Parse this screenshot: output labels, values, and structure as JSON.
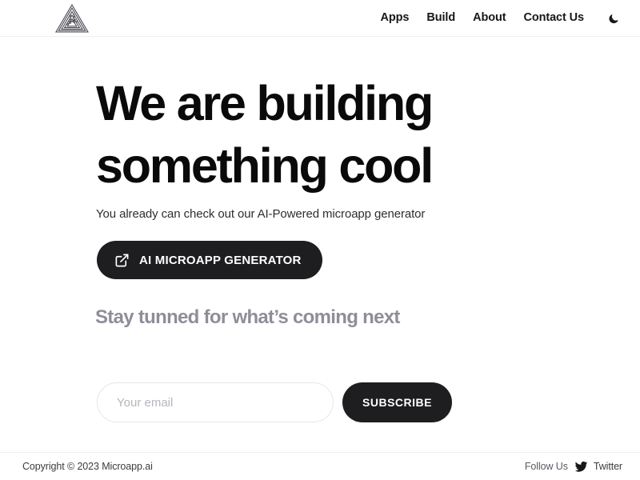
{
  "header": {
    "logo_icon": "impossible-triangle-logo",
    "nav": [
      {
        "label": "Apps"
      },
      {
        "label": "Build"
      },
      {
        "label": "About"
      },
      {
        "label": "Contact Us"
      }
    ],
    "theme_toggle_icon": "moon-icon"
  },
  "hero": {
    "title_line1": "We are building",
    "title_line2": "something cool",
    "subtitle": "You already can check out our AI-Powered microapp generator",
    "cta": {
      "label": "AI MICROAPP GENERATOR",
      "icon": "external-link-icon"
    }
  },
  "newsletter": {
    "heading": "Stay tunned for what’s coming next",
    "email_placeholder": "Your email",
    "email_value": "",
    "subscribe_label": "SUBSCRIBE"
  },
  "footer": {
    "copyright": "Copyright © 2023 Microapp.ai",
    "follow_label": "Follow Us",
    "twitter_label": "Twitter",
    "twitter_icon": "twitter-bird-icon"
  },
  "colors": {
    "background": "#ffffff",
    "text": "#0a0a0a",
    "button_dark": "#1e1e21",
    "muted": "#8e8e99",
    "border": "#e6e6e9"
  }
}
